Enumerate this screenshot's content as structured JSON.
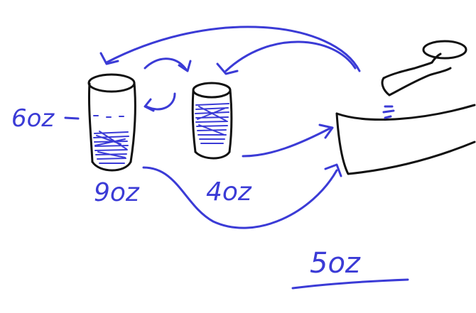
{
  "labels": {
    "left_side_mark": "6oz",
    "jug_9_capacity": "9oz",
    "jug_4_capacity": "4oz",
    "target_amount": "5oz"
  },
  "colors": {
    "ink": "#3b3bd6",
    "outline": "#111111",
    "background": "#ffffff"
  }
}
